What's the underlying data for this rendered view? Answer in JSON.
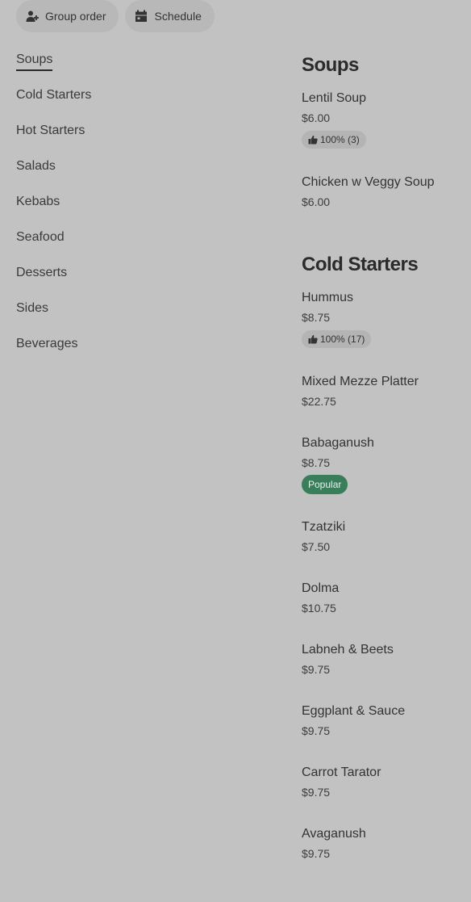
{
  "colors": {
    "background": "#c2c2c2",
    "pill_background": "#b8b8b8",
    "popular_badge": "#3a7d5a"
  },
  "toolbar": {
    "group_order": {
      "label": "Group order",
      "icon": "add-person-icon"
    },
    "schedule": {
      "label": "Schedule",
      "icon": "calendar-icon"
    }
  },
  "nav": {
    "active": "Soups",
    "items": [
      {
        "label": "Soups"
      },
      {
        "label": "Cold Starters"
      },
      {
        "label": "Hot Starters"
      },
      {
        "label": "Salads"
      },
      {
        "label": "Kebabs"
      },
      {
        "label": "Seafood"
      },
      {
        "label": "Desserts"
      },
      {
        "label": "Sides"
      },
      {
        "label": "Beverages"
      }
    ]
  },
  "sections": [
    {
      "title": "Soups",
      "items": [
        {
          "name": "Lentil Soup",
          "price": "$6.00",
          "rating": "100% (3)"
        },
        {
          "name": "Chicken w Veggy Soup",
          "price": "$6.00"
        }
      ]
    },
    {
      "title": "Cold Starters",
      "items": [
        {
          "name": "Hummus",
          "price": "$8.75",
          "rating": "100% (17)"
        },
        {
          "name": "Mixed Mezze Platter",
          "price": "$22.75"
        },
        {
          "name": "Babaganush",
          "price": "$8.75",
          "badge": "Popular"
        },
        {
          "name": "Tzatziki",
          "price": "$7.50"
        },
        {
          "name": "Dolma",
          "price": "$10.75"
        },
        {
          "name": "Labneh & Beets",
          "price": "$9.75"
        },
        {
          "name": "Eggplant & Sauce",
          "price": "$9.75"
        },
        {
          "name": "Carrot Tarator",
          "price": "$9.75"
        },
        {
          "name": "Avaganush",
          "price": "$9.75"
        }
      ]
    }
  ]
}
